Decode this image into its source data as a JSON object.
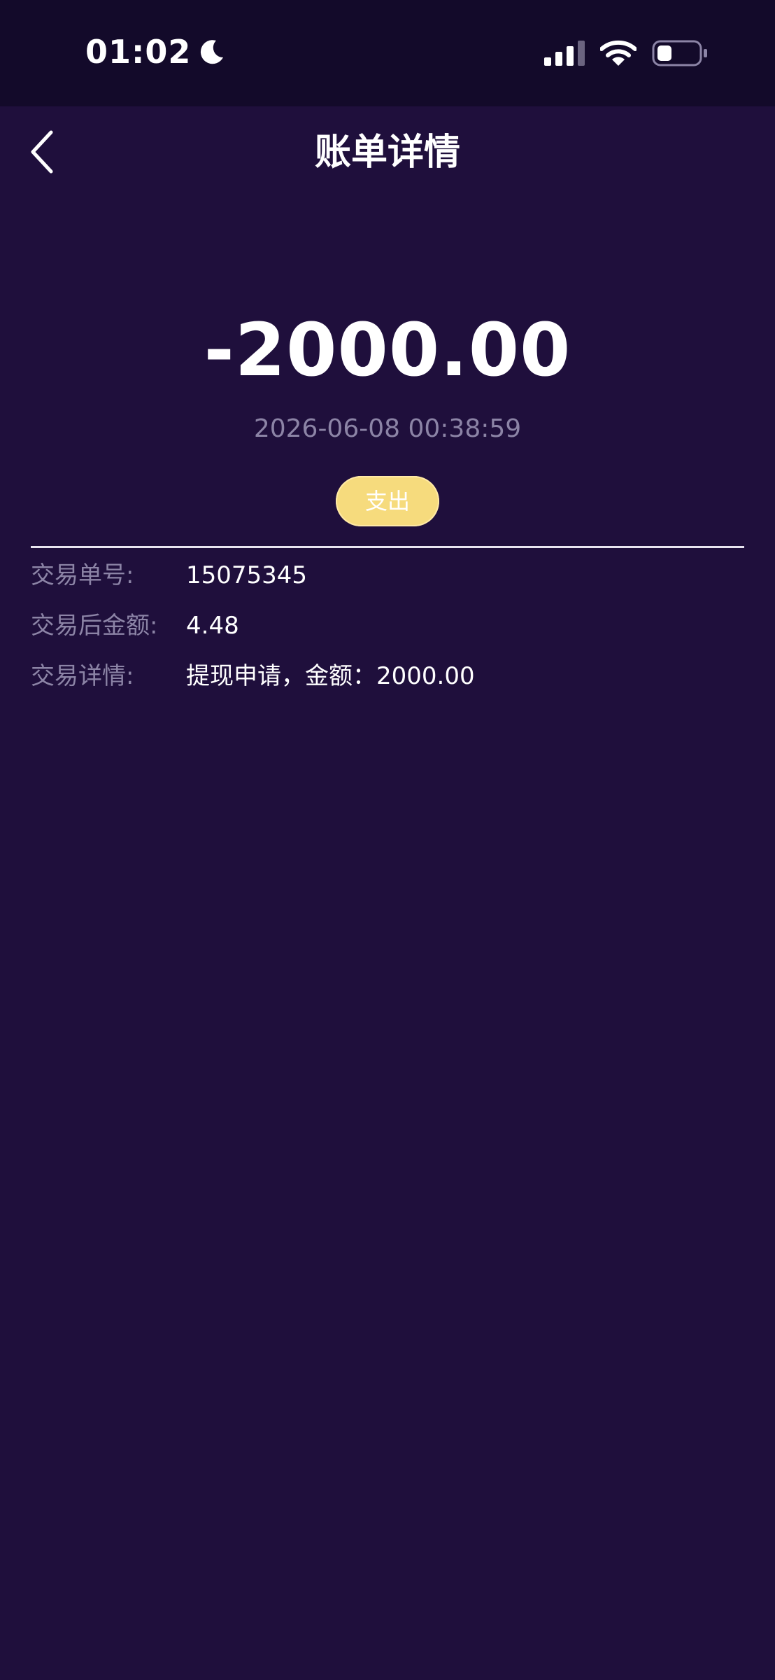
{
  "status_bar": {
    "time": "01:02",
    "icons": [
      "moon-icon",
      "signal-icon",
      "wifi-icon",
      "battery-icon"
    ]
  },
  "nav": {
    "title": "账单详情",
    "back_icon": "chevron-left-icon"
  },
  "transaction": {
    "amount": "-2000.00",
    "datetime": "2026-06-08 00:38:59",
    "type_label": "支出"
  },
  "details": [
    {
      "label": "交易单号:",
      "value": "15075345"
    },
    {
      "label": "交易后金额:",
      "value": "4.48"
    },
    {
      "label": "交易详情:",
      "value": "提现申请，金额：2000.00"
    }
  ],
  "colors": {
    "background": "#1f0f3c",
    "status_bar": "#130a2a",
    "muted_text": "#8c84a6",
    "badge": "#f6db7d"
  }
}
